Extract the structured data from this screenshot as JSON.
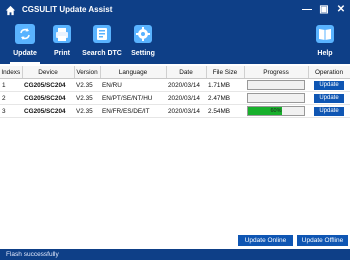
{
  "window": {
    "title": "CGSULIT Update Assist",
    "minimize_glyph": "—",
    "maximize_glyph": "▣",
    "close_glyph": "✕"
  },
  "toolbar": {
    "items": [
      {
        "label": "Update",
        "icon": "refresh-icon"
      },
      {
        "label": "Print",
        "icon": "printer-icon"
      },
      {
        "label": "Search DTC",
        "icon": "search-dtc-icon"
      },
      {
        "label": "Setting",
        "icon": "gear-icon"
      },
      {
        "label": "Help",
        "icon": "help-book-icon"
      }
    ]
  },
  "table": {
    "headers": [
      "Indexs",
      "Device",
      "Version",
      "Language",
      "Date",
      "File Size",
      "Progress",
      "Operation"
    ],
    "rows": [
      {
        "index": "1",
        "device": "CG205/SC204",
        "version": "V2.35",
        "language": "EN/RU",
        "date": "2020/03/14",
        "size": "1.71MB",
        "progress": 0,
        "progress_text": "",
        "operation": "Update"
      },
      {
        "index": "2",
        "device": "CG205/SC204",
        "version": "V2.35",
        "language": "EN/PT/SE/NT/HU",
        "date": "2020/03/14",
        "size": "2.47MB",
        "progress": 0,
        "progress_text": "",
        "operation": "Update"
      },
      {
        "index": "3",
        "device": "CG205/SC204",
        "version": "V2.35",
        "language": "EN/FR/ES/DE/IT",
        "date": "2020/03/14",
        "size": "2.54MB",
        "progress": 0.6,
        "progress_text": "60%",
        "operation": "Update"
      }
    ]
  },
  "actions": {
    "update_online": "Update Online",
    "update_offline": "Update Offline"
  },
  "status": {
    "message": "Flash successfully"
  },
  "colors": {
    "header": "#0e3f87",
    "accent_button": "#0f56b3",
    "active_tab": "#5cb3ff",
    "progress_fill": "#18b02c"
  }
}
